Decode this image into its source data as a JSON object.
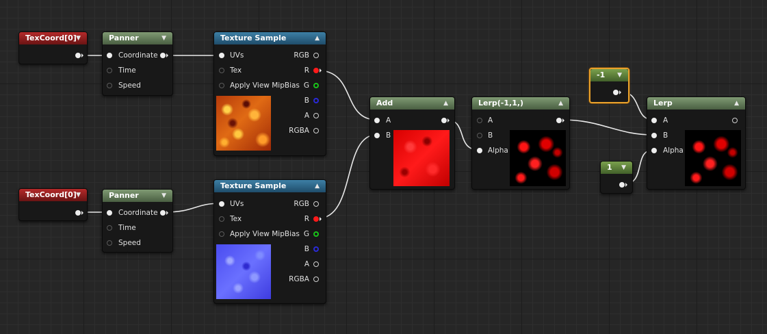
{
  "nodes": {
    "texcoord1": {
      "title": "TexCoord[0]"
    },
    "texcoord2": {
      "title": "TexCoord[0]"
    },
    "panner1": {
      "title": "Panner",
      "pins": [
        "Coordinate",
        "Time",
        "Speed"
      ]
    },
    "panner2": {
      "title": "Panner",
      "pins": [
        "Coordinate",
        "Time",
        "Speed"
      ]
    },
    "texsample1": {
      "title": "Texture Sample",
      "inputs": [
        "UVs",
        "Tex",
        "Apply View MipBias"
      ],
      "outputs": [
        "RGB",
        "R",
        "G",
        "B",
        "A",
        "RGBA"
      ],
      "preview": "fire-texture"
    },
    "texsample2": {
      "title": "Texture Sample",
      "inputs": [
        "UVs",
        "Tex",
        "Apply View MipBias"
      ],
      "outputs": [
        "RGB",
        "R",
        "G",
        "B",
        "A",
        "RGBA"
      ],
      "preview": "normal-map-texture"
    },
    "add": {
      "title": "Add",
      "inputs": [
        "A",
        "B"
      ],
      "preview": "red-texture"
    },
    "lerp_custom": {
      "title": "Lerp(-1,1,)",
      "inputs": [
        "A",
        "B",
        "Alpha"
      ],
      "preview": "red-mask"
    },
    "const_neg1": {
      "title": "-1"
    },
    "const_1": {
      "title": "1"
    },
    "lerp": {
      "title": "Lerp",
      "inputs": [
        "A",
        "B",
        "Alpha"
      ],
      "preview": "red-mask"
    }
  },
  "colors": {
    "texcoord_header": "#b52a2a",
    "panner_header": "#7f9a73",
    "texture_header": "#3d7fa5",
    "constant_header": "#7aa04d",
    "selection_outline": "#e8a12c",
    "wire": "#e8e8e8",
    "pin_r": "#ff1a1a",
    "pin_g": "#19c419",
    "pin_b": "#2a2ad8"
  }
}
